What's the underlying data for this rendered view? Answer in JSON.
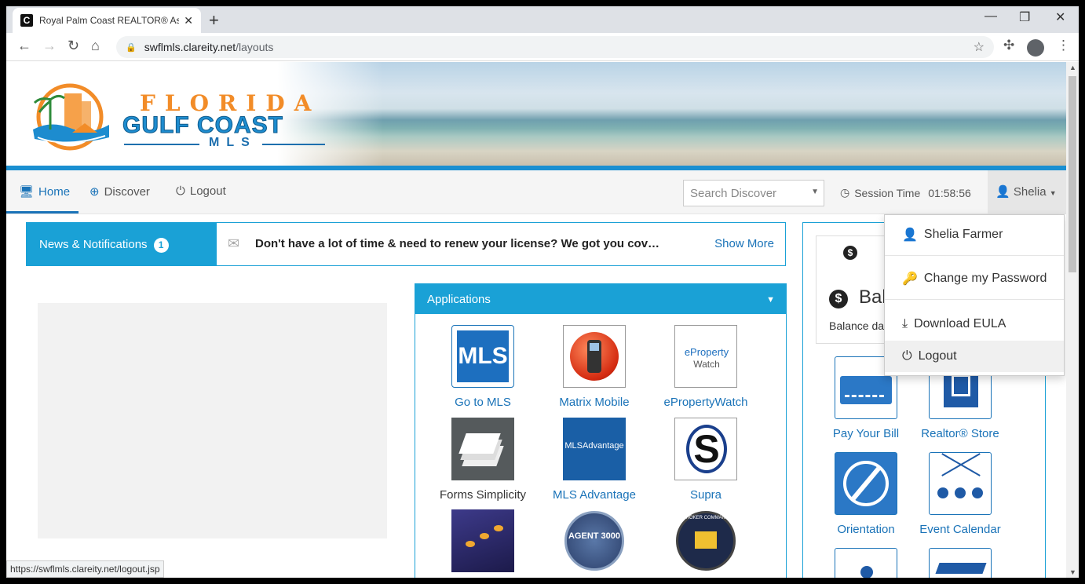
{
  "browser": {
    "tab_title": "Royal Palm Coast REALTOR® Ass",
    "tab_favicon": "C",
    "url_host": "swflmls.clareity.net",
    "url_path": "/layouts",
    "status_url": "https://swflmls.clareity.net/logout.jsp"
  },
  "logo": {
    "line1": "FLORIDA",
    "line2": "GULF COAST",
    "line3": "MLS"
  },
  "nav": {
    "home": "Home",
    "discover": "Discover",
    "logout": "Logout",
    "search_placeholder": "Search Discover",
    "session_label": "Session Time",
    "session_value": "01:58:56",
    "user": "Shelia"
  },
  "news": {
    "label": "News & Notifications",
    "count": "1",
    "message": "Don't have a lot of time & need to renew your license? We got you cov…",
    "show_more": "Show More"
  },
  "applications": {
    "title": "Applications",
    "items": [
      {
        "label": "Go to MLS"
      },
      {
        "label": "Matrix Mobile"
      },
      {
        "label": "ePropertyWatch"
      },
      {
        "label": "Forms Simplicity"
      },
      {
        "label": "MLS Advantage"
      },
      {
        "label": "Supra"
      }
    ],
    "icon_text": {
      "mls": "MLS",
      "eprop_1": "eProperty",
      "eprop_2": "Watch",
      "mlsadv": "MLSAdvantage",
      "agent": "AGENT 3000",
      "broker": "BROKER COMMAND"
    }
  },
  "balance": {
    "title": "Bal",
    "desc": "Balance da"
  },
  "right_tiles": [
    {
      "label": "Pay Your Bill"
    },
    {
      "label": "Realtor® Store"
    },
    {
      "label": "Orientation"
    },
    {
      "label": "Event Calendar"
    }
  ],
  "user_menu": {
    "name": "Shelia Farmer",
    "change_password": "Change my Password",
    "download_eula": "Download EULA",
    "logout": "Logout"
  },
  "colors": {
    "accent": "#1aa1d6",
    "link": "#1a73b8",
    "logo_orange": "#f28c28"
  }
}
